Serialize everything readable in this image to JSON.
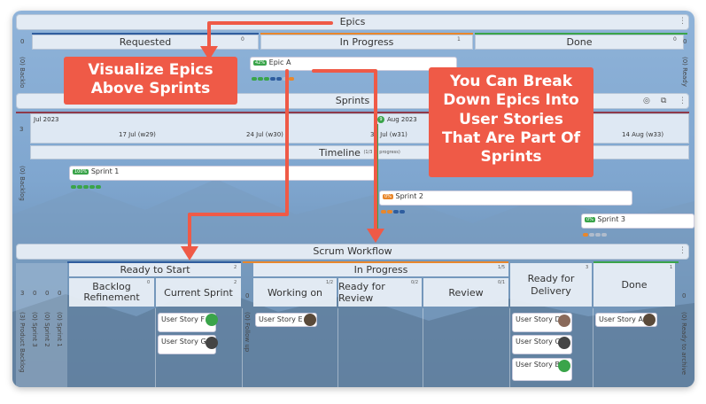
{
  "colors": {
    "accent": "#ef5a47",
    "done_green": "#3aa44a",
    "progress_orange": "#e8872c",
    "blue": "#2f5d9e"
  },
  "epics": {
    "title": "Epics",
    "zero": "0",
    "cols": [
      {
        "label": "Requested",
        "count": "0"
      },
      {
        "label": "In Progress",
        "count": "1"
      },
      {
        "label": "Done",
        "count": "0"
      }
    ],
    "left_label": "(0) Backlo",
    "right_label": "(0) Ready",
    "card": {
      "pct": "42%",
      "title": "Epic A"
    }
  },
  "sprints": {
    "title": "Sprints",
    "three": "3",
    "month1": "Jul 2023",
    "month2": "Aug 2023",
    "month2_icon": "9",
    "weeks": [
      "17 Jul (w29)",
      "24 Jul (w30)",
      "31 Jul (w31)",
      "14 Aug (w33)"
    ],
    "timeline": "Timeline",
    "timeline_sub": "(1/3 In progress)",
    "backlog_label": "(0) Backlog",
    "items": [
      {
        "pct": "100%",
        "name": "Sprint 1"
      },
      {
        "pct": "0%",
        "name": "Sprint 2"
      },
      {
        "pct": "0%",
        "name": "Sprint 3"
      }
    ]
  },
  "scrum": {
    "title": "Scrum Workflow",
    "groups": [
      {
        "label": "Ready to Start",
        "count": "2"
      },
      {
        "label": "In Progress",
        "count": "1/5"
      }
    ],
    "cols": [
      {
        "label": "Backlog Refinement",
        "count": "0"
      },
      {
        "label": "Current Sprint",
        "count": "2"
      },
      {
        "label": "Working on",
        "count": "1/2"
      },
      {
        "label": "Ready for Review",
        "count": "0/2"
      },
      {
        "label": "Review",
        "count": "0/1"
      },
      {
        "label": "Ready for Delivery",
        "count": "3"
      },
      {
        "label": "Done",
        "count": "1"
      }
    ],
    "left_counts": [
      "3",
      "0",
      "0",
      "0"
    ],
    "left_labels": [
      "(3) Product Backlog",
      "(0) Sprint 3",
      "(0) Sprint 2",
      "(0) Sprint 1"
    ],
    "follow_label": "(0) Follow up",
    "right_label": "(0) Ready to archive",
    "cards": {
      "f": "User Story F",
      "g": "User Story G",
      "e": "User Story E",
      "d": "User Story D",
      "c": "User Story C",
      "b": "User Story B",
      "a": "User Story A"
    }
  },
  "callouts": {
    "left": "Visualize Epics Above Sprints",
    "right": "You Can Break Down Epics Into User Stories That Are Part Of Sprints"
  },
  "icons": [
    "kebab-icon",
    "target-icon",
    "expand-icon",
    "avatar-icon"
  ]
}
